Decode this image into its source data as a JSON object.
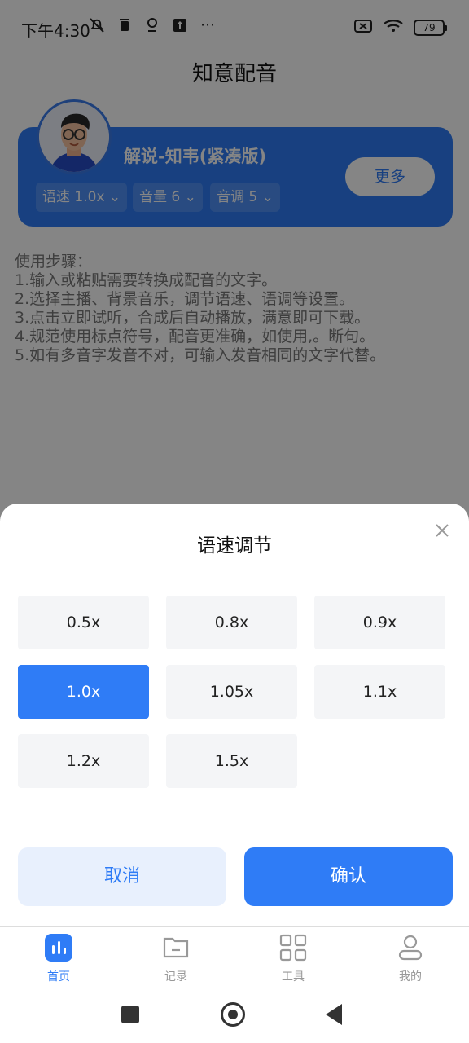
{
  "status_bar": {
    "time": "下午4:30",
    "battery": "79",
    "left_icons": [
      "muted-bell-icon",
      "trash-icon",
      "location-icon",
      "upload-icon",
      "more-icon"
    ],
    "right_icons": [
      "sim-off-icon",
      "wifi-icon",
      "battery-icon"
    ]
  },
  "header": {
    "title": "知意配音"
  },
  "voice_card": {
    "name": "解说-知韦(紧凑版)",
    "more_label": "更多",
    "speed_label": "语速 1.0x",
    "volume_label": "音量 6",
    "pitch_label": "音调 5"
  },
  "instructions": {
    "title": "使用步骤：",
    "steps": [
      "1.输入或粘贴需要转换成配音的文字。",
      "2.选择主播、背景音乐，调节语速、语调等设置。",
      "3.点击立即试听，合成后自动播放，满意即可下载。",
      "4.规范使用标点符号，配音更准确，如使用,。断句。",
      "5.如有多音字发音不对，可输入发音相同的文字代替。"
    ]
  },
  "speed_sheet": {
    "title": "语速调节",
    "options": [
      "0.5x",
      "0.8x",
      "0.9x",
      "1.0x",
      "1.05x",
      "1.1x",
      "1.2x",
      "1.5x"
    ],
    "selected": "1.0x",
    "cancel_label": "取消",
    "confirm_label": "确认"
  },
  "tabbar": {
    "items": [
      {
        "label": "首页",
        "icon": "chart-icon",
        "active": true
      },
      {
        "label": "记录",
        "icon": "folder-icon",
        "active": false
      },
      {
        "label": "工具",
        "icon": "grid-icon",
        "active": false
      },
      {
        "label": "我的",
        "icon": "profile-icon",
        "active": false
      }
    ]
  },
  "colors": {
    "accent": "#2f7cf6",
    "overlay": "rgba(0,0,0,0.48)"
  }
}
